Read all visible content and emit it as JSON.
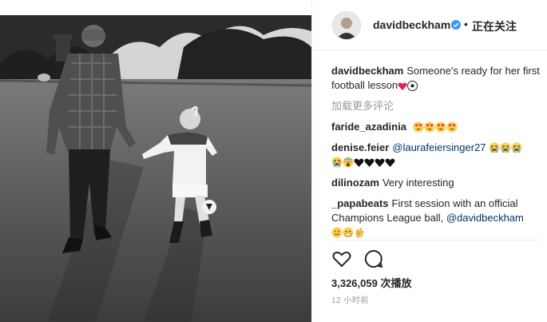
{
  "post": {
    "author": "davidbeckham",
    "follow_status": "正在关注",
    "separator": "•",
    "caption_user": "davidbeckham",
    "caption_text": "Someone's ready for her first football lesson",
    "caption_emojis": [
      "heart-emoji",
      "soccer-ball-emoji"
    ],
    "load_more": "加载更多评论",
    "likes": "3,326,059 次播放",
    "timestamp": "12 小时前"
  },
  "comments": [
    {
      "user": "faride_azadinia",
      "text": "",
      "emojis": [
        "heart-eyes-emoji",
        "heart-eyes-emoji",
        "heart-eyes-emoji",
        "heart-eyes-emoji"
      ]
    },
    {
      "user": "denise.feier",
      "mention": "@laurafeiersinger27",
      "text": "",
      "emojis": [
        "crying-emoji",
        "crying-emoji",
        "crying-emoji",
        "crying-emoji",
        "black-heart-emoji",
        "black-heart-emoji",
        "black-heart-emoji",
        "black-heart-emoji"
      ]
    },
    {
      "user": "dilinozam",
      "text": "Very interesting",
      "emojis": []
    },
    {
      "user": "_papabeats",
      "text": "First session with an official Champions League ball, ",
      "mention": "@davidbeckham",
      "emojis": [
        "smile-emoji",
        "grin-emoji",
        "ok-hand-emoji"
      ]
    }
  ],
  "icons": {
    "like": "heart-outline-icon",
    "comment": "comment-bubble-icon",
    "verified": "verified-badge-icon"
  },
  "colors": {
    "verified": "#3897f0",
    "link": "#003569",
    "muted": "#999999",
    "text": "#262626"
  }
}
